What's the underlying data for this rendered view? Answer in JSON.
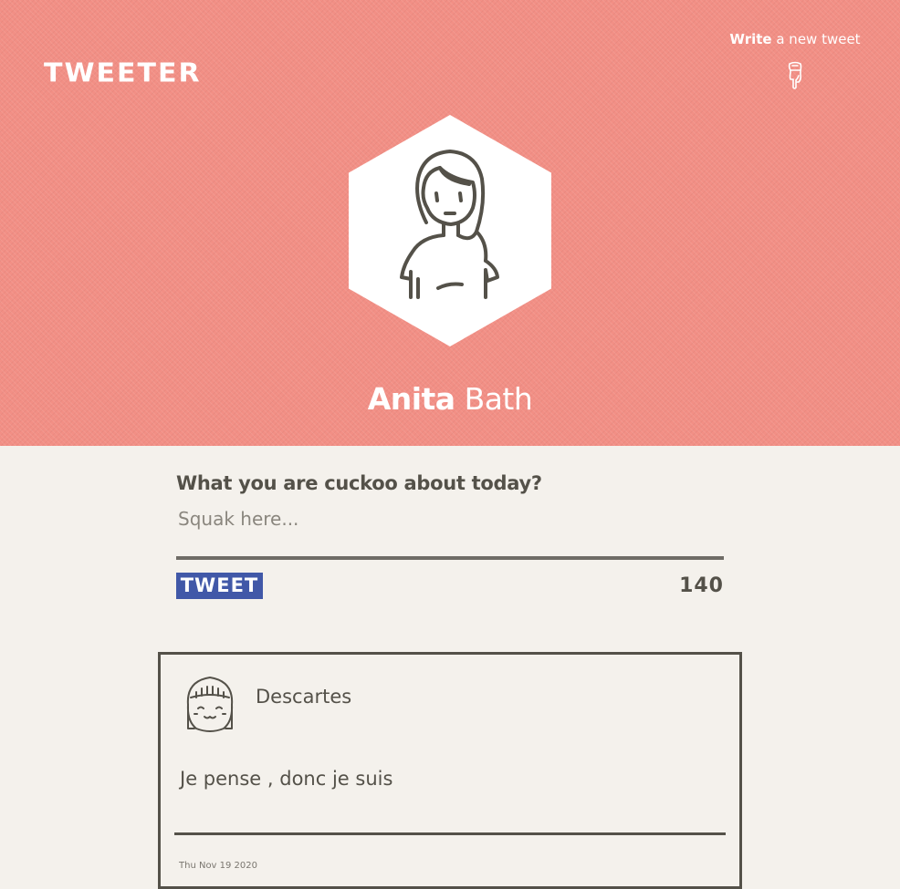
{
  "header": {
    "logo": "TWEETER",
    "write_link": {
      "strong": "Write",
      "rest": " a new tweet"
    },
    "hand_icon": "pointing-hand-down-icon",
    "background_color": "#f28f85"
  },
  "profile": {
    "first_name": "Anita",
    "last_name": " Bath",
    "avatar_icon": "woman-avatar-icon"
  },
  "composer": {
    "label": "What you are cuckoo about today?",
    "placeholder": "Squak here...",
    "value": "",
    "button_label": "TWEET",
    "counter": "140",
    "button_color": "#4158a8"
  },
  "tweets": [
    {
      "author": "Descartes",
      "avatar_icon": "smiling-girl-avatar-icon",
      "text": "Je pense , donc je suis",
      "date": "Thu Nov 19 2020"
    }
  ]
}
